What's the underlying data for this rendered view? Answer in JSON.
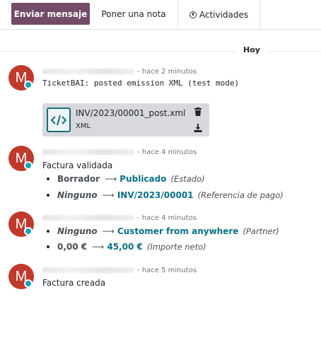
{
  "tabs": {
    "send_label": "Enviar mensaje",
    "note_label": "Poner una nota",
    "activities_label": "Actividades"
  },
  "date_separator": "Hoy",
  "messages": [
    {
      "avatar_letter": "M",
      "time": "- hace 2 minutos",
      "text": "TicketBAI: posted emission XML (test mode)",
      "attachment": {
        "name": "INV/2023/00001_post.xml",
        "type": "XML"
      }
    },
    {
      "avatar_letter": "M",
      "time": "- hace 4 minutos",
      "text": "Factura validada",
      "tracking": [
        {
          "old": "Borrador",
          "new": "Publicado",
          "field": "(Estado)"
        },
        {
          "old": "Ninguno",
          "new": "INV/2023/00001",
          "field": "(Referencia de pago)"
        }
      ]
    },
    {
      "avatar_letter": "M",
      "time": "- hace 4 minutos",
      "tracking": [
        {
          "old": "Ninguno",
          "new": "Customer from anywhere",
          "field": "(Partner)"
        },
        {
          "old": "0,00 €",
          "new": "45,00 €",
          "field": "(Importe neto)"
        }
      ]
    },
    {
      "avatar_letter": "M",
      "time": "- hace 5 minutos",
      "text": "Factura creada"
    }
  ],
  "colors": {
    "primary": "#714b67",
    "avatar": "#c0392b",
    "online": "#17a2b8",
    "link": "#0a7185"
  }
}
